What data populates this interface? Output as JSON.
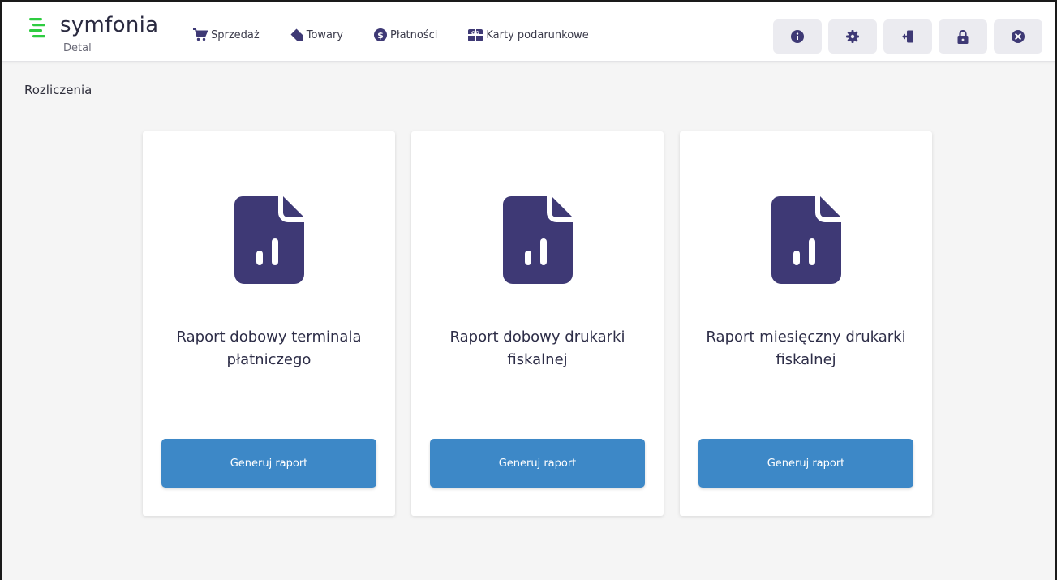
{
  "colors": {
    "accent": "#3d88c7",
    "icon": "#3e3975",
    "logo_green": "#2ecc40"
  },
  "app": {
    "name": "symfonia",
    "edition": "Detal"
  },
  "nav": {
    "items": [
      {
        "label": "Sprzedaż",
        "icon": "cart-icon"
      },
      {
        "label": "Towary",
        "icon": "tag-icon"
      },
      {
        "label": "Płatności",
        "icon": "dollar-circle-icon"
      },
      {
        "label": "Karty podarunkowe",
        "icon": "gift-card-icon"
      }
    ]
  },
  "toolbar": {
    "buttons": [
      {
        "icon": "info-icon"
      },
      {
        "icon": "gear-icon"
      },
      {
        "icon": "logout-icon"
      },
      {
        "icon": "lock-icon"
      },
      {
        "icon": "close-circle-icon"
      }
    ]
  },
  "page": {
    "title": "Rozliczenia"
  },
  "cards": [
    {
      "title": "Raport dobowy terminala płatniczego",
      "button": "Generuj raport",
      "icon": "report-file-icon"
    },
    {
      "title": "Raport dobowy drukarki fiskalnej",
      "button": "Generuj raport",
      "icon": "report-file-icon"
    },
    {
      "title": "Raport miesięczny drukarki fiskalnej",
      "button": "Generuj raport",
      "icon": "report-file-icon"
    }
  ]
}
